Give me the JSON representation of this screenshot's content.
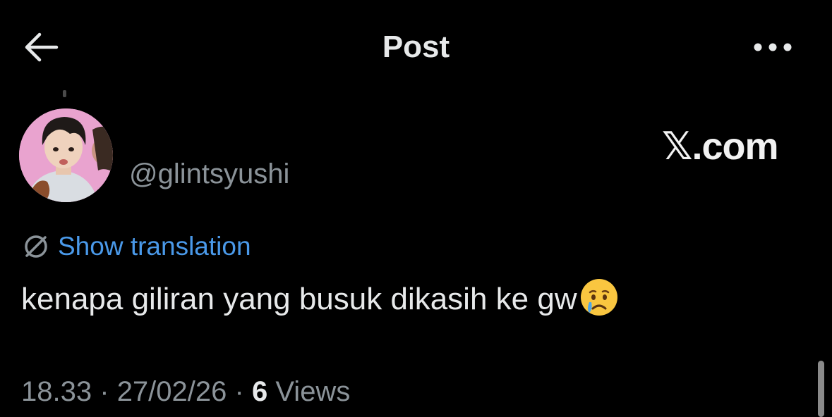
{
  "header": {
    "title": "Post",
    "back_icon": "arrow-left-icon",
    "more_icon": "more-horizontal-icon"
  },
  "post": {
    "handle": "@glintsyushi",
    "translation_label": "Show translation",
    "text": "kenapa giliran yang busuk dikasih ke gw",
    "emoji": "crying-face-emoji",
    "time": "18.33",
    "date": "27/02/26",
    "views_count": "6",
    "views_label": "Views",
    "separator": "·"
  },
  "watermark": "𝕏.com",
  "colors": {
    "background": "#000000",
    "text": "#e7e9ea",
    "muted": "#8b9399",
    "link": "#4a99e9",
    "avatar_bg": "#e9a3cf"
  }
}
